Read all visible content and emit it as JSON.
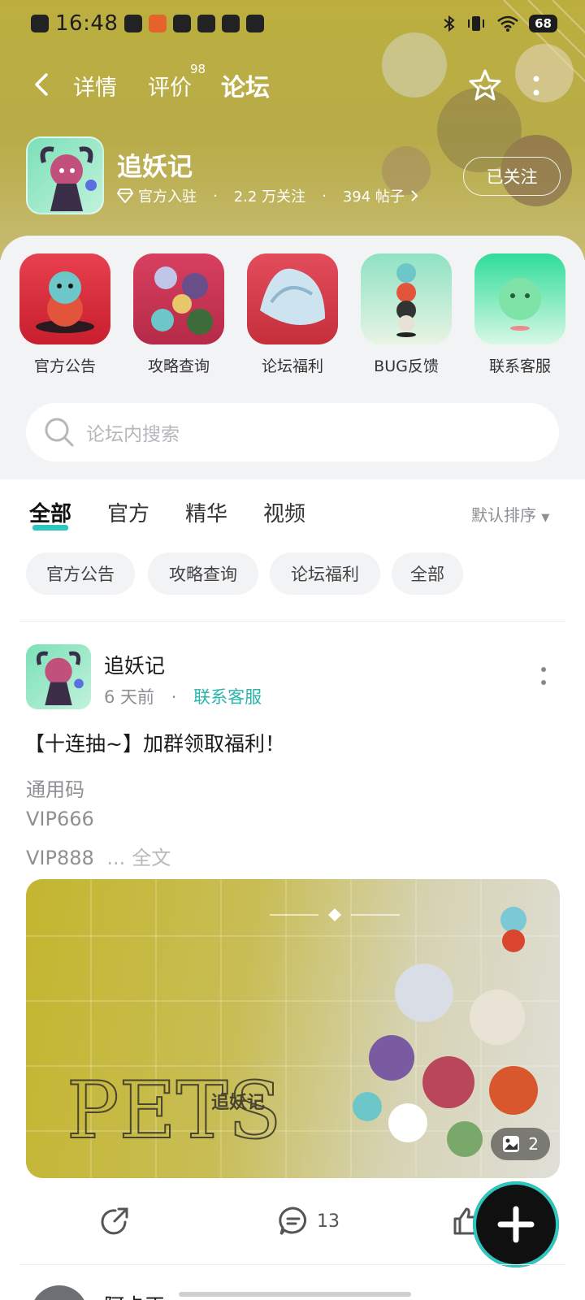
{
  "status_bar": {
    "time": "16:48",
    "battery": "68"
  },
  "nav": {
    "tabs": [
      {
        "label": "详情"
      },
      {
        "label": "评价",
        "badge": "98"
      },
      {
        "label": "论坛"
      }
    ],
    "active_tab": "论坛"
  },
  "game": {
    "title": "追妖记",
    "official_label": "官方入驻",
    "followers": "2.2 万关注",
    "posts": "394 帖子",
    "follow_button": "已关注"
  },
  "quick_links": [
    {
      "label": "官方公告"
    },
    {
      "label": "攻略查询"
    },
    {
      "label": "论坛福利"
    },
    {
      "label": "BUG反馈"
    },
    {
      "label": "联系客服"
    }
  ],
  "search": {
    "placeholder": "论坛内搜索"
  },
  "filter_tabs": [
    {
      "label": "全部",
      "active": true
    },
    {
      "label": "官方"
    },
    {
      "label": "精华"
    },
    {
      "label": "视频"
    }
  ],
  "sort": {
    "label": "默认排序"
  },
  "chips": [
    {
      "label": "官方公告"
    },
    {
      "label": "攻略查询"
    },
    {
      "label": "论坛福利"
    },
    {
      "label": "全部"
    }
  ],
  "post": {
    "author": "追妖记",
    "time": "6 天前",
    "category": "联系客服",
    "title": "【十连抽~】加群领取福利！",
    "body_lines": [
      "通用码",
      "VIP666",
      "VIP888"
    ],
    "ellipsis": "...",
    "read_more": "全文",
    "image_text": "PETS",
    "image_subtitle": "追妖记",
    "image_count": "2",
    "comments": "13"
  },
  "next_post": {
    "author_partial": "阿卡正"
  },
  "colors": {
    "accent": "#2ec7c0",
    "header": "#bcae3e"
  }
}
